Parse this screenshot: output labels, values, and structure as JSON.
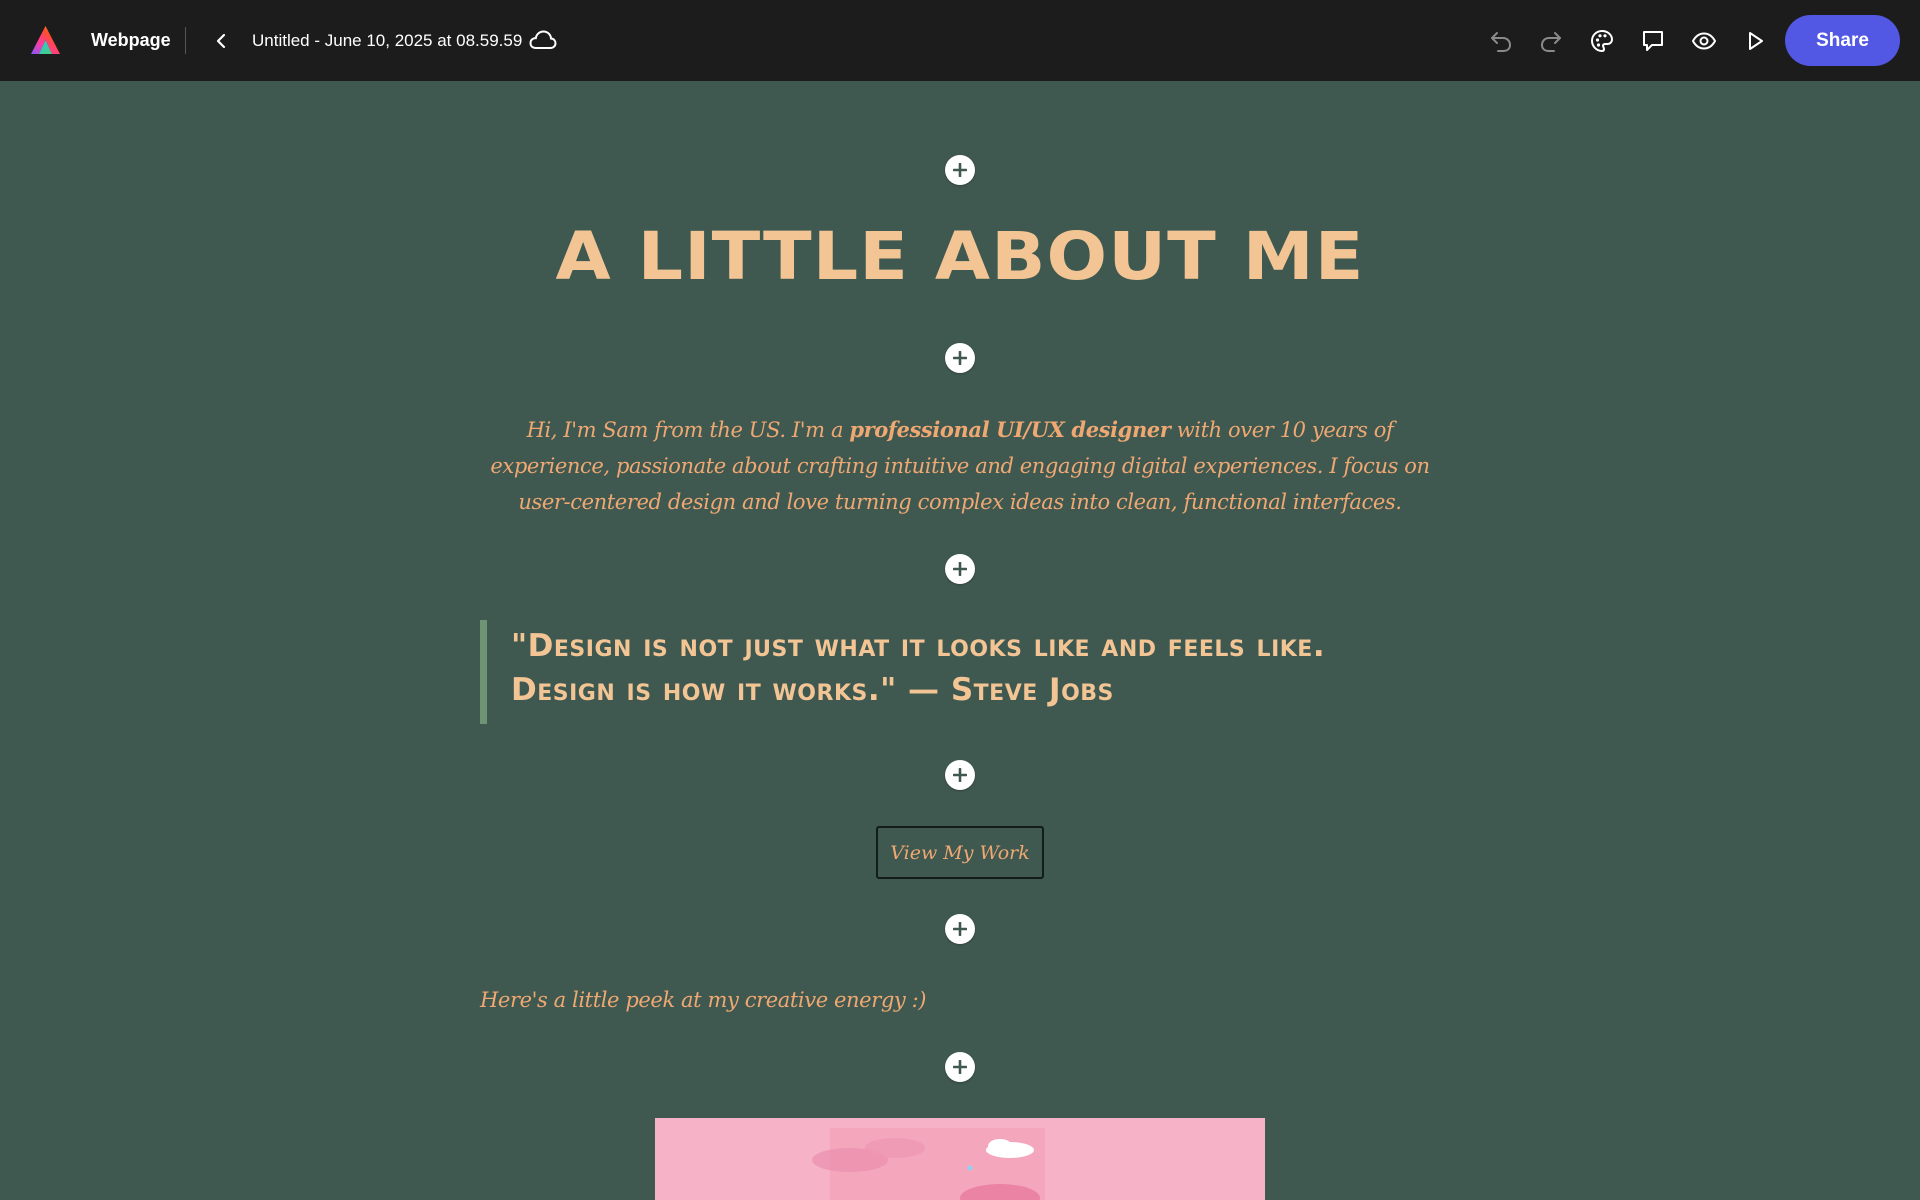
{
  "app": {
    "name": "Webpage",
    "document_title": "Untitled - June 10, 2025 at 08.59.59"
  },
  "toolbar": {
    "share_label": "Share",
    "icons": [
      "undo-icon",
      "redo-icon",
      "palette-icon",
      "comment-icon",
      "preview-eye-icon",
      "play-icon"
    ],
    "accent_color": "#5258e4"
  },
  "canvas": {
    "background_color": "#3f5951",
    "heading": "A LITTLE ABOUT ME",
    "intro": {
      "before_bold": "Hi, I'm Sam from the US. I'm a ",
      "bold": "professional UI/UX designer",
      "after_bold": " with over 10 years of experience, passionate about crafting intuitive and engaging digital experiences. I focus on user-centered design and love turning complex ideas into clean, functional interfaces."
    },
    "quote": "\"Design is not just what it looks like and feels like. Design is how it works.\" — Steve Jobs",
    "button_label": "View My Work",
    "peek_text": "Here's a little peek at my creative energy :)",
    "heading_color": "#f3c595",
    "body_text_color": "#f0a872"
  }
}
